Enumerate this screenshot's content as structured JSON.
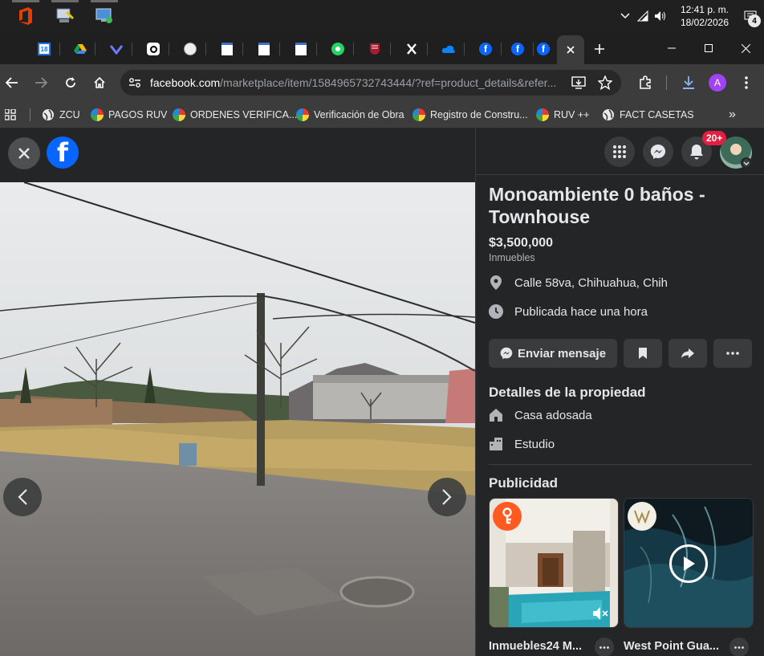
{
  "taskbar": {
    "clock_time": "12:41 p. m.",
    "clock_date": "18/02/2026",
    "notification_count": "4"
  },
  "tabs": {
    "calendar_day": "18"
  },
  "address_bar": {
    "domain": "facebook.com",
    "path": "/marketplace/item/1584965732743444/?ref=product_details&refer...",
    "profile_initial": "A"
  },
  "bookmarks": [
    {
      "label": "ZCU",
      "icon": "globe-icon"
    },
    {
      "label": "PAGOS RUV",
      "icon": "ruv-icon"
    },
    {
      "label": "ORDENES VERIFICA...",
      "icon": "ruv-icon"
    },
    {
      "label": "Verificación de Obra",
      "icon": "ruv-icon"
    },
    {
      "label": "Registro de Constru...",
      "icon": "ruv-icon"
    },
    {
      "label": "RUV ++",
      "icon": "ruv-icon"
    },
    {
      "label": "FACT CASETAS",
      "icon": "globe-icon"
    }
  ],
  "bookmarks_overflow": "»",
  "facebook": {
    "logo_letter": "f",
    "notification_badge": "20+"
  },
  "listing": {
    "title": "Monoambiente 0 baños - Townhouse",
    "price": "$3,500,000",
    "category": "Inmuebles",
    "location": "Calle 58va, Chihuahua, Chih",
    "published": "Publicada hace una hora",
    "message_button": "Enviar mensaje",
    "details_heading": "Detalles de la propiedad",
    "property_type": "Casa adosada",
    "layout": "Estudio",
    "ads_heading": "Publicidad"
  },
  "ads": [
    {
      "title": "Inmuebles24 M..."
    },
    {
      "title": "West Point Gua..."
    }
  ],
  "colors": {
    "fb_blue": "#0866ff",
    "panel_bg": "#242526",
    "button_bg": "#3a3b3c",
    "badge_red": "#e41e3f"
  }
}
